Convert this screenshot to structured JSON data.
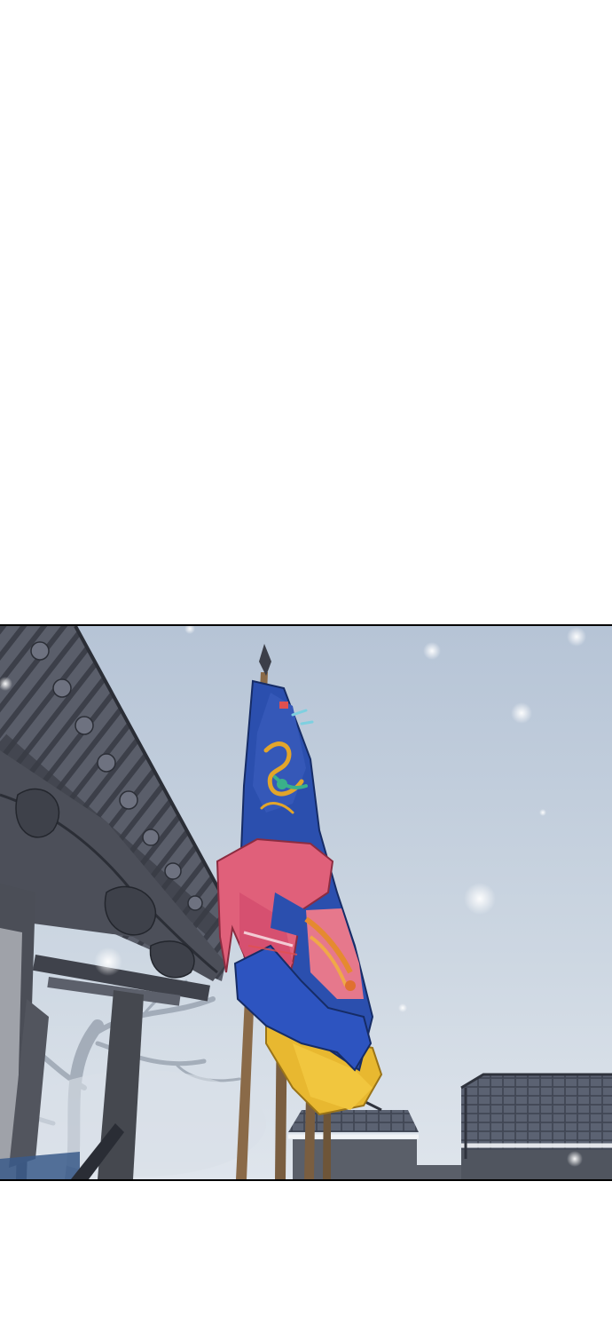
{
  "page": {
    "background": "#ffffff"
  },
  "panel": {
    "scene": "snowy-palace-courtyard",
    "colors": {
      "sky": "#c9d4e0",
      "roof": "#4a4e5a",
      "flag_blue": "#2b4fae",
      "flag_pink": "#e0607a",
      "flag_yellow": "#e8b830",
      "pole": "#8a6a48"
    }
  }
}
